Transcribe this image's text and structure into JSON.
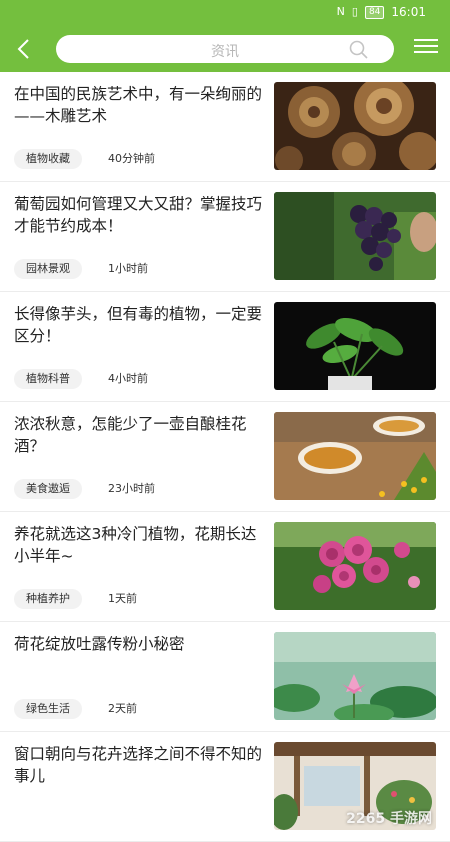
{
  "status": {
    "battery": "84",
    "time": "16:01"
  },
  "header": {
    "search_placeholder": "资讯"
  },
  "articles": [
    {
      "title": "在中国的民族艺术中，有一朵绚丽的——木雕艺术",
      "tag": "植物收藏",
      "time": "40分钟前",
      "thumb": "wood-carving"
    },
    {
      "title": "葡萄园如何管理又大又甜？掌握技巧才能节约成本！",
      "tag": "园林景观",
      "time": "1小时前",
      "thumb": "grapes"
    },
    {
      "title": "长得像芋头，但有毒的植物，一定要区分！",
      "tag": "植物科普",
      "time": "4小时前",
      "thumb": "taro-plant"
    },
    {
      "title": "浓浓秋意，怎能少了一壶自酿桂花酒？",
      "tag": "美食遨逅",
      "time": "23小时前",
      "thumb": "osmanthus-wine"
    },
    {
      "title": "养花就选这3种冷门植物，花期长达小半年~",
      "tag": "种植养护",
      "time": "1天前",
      "thumb": "roses"
    },
    {
      "title": "荷花绽放吐露传粉小秘密",
      "tag": "绿色生活",
      "time": "2天前",
      "thumb": "lotus"
    },
    {
      "title": "窗口朝向与花卉选择之间不得不知的事儿",
      "tag": "",
      "time": "",
      "thumb": "window-garden"
    }
  ],
  "watermark": "2265 手游网"
}
